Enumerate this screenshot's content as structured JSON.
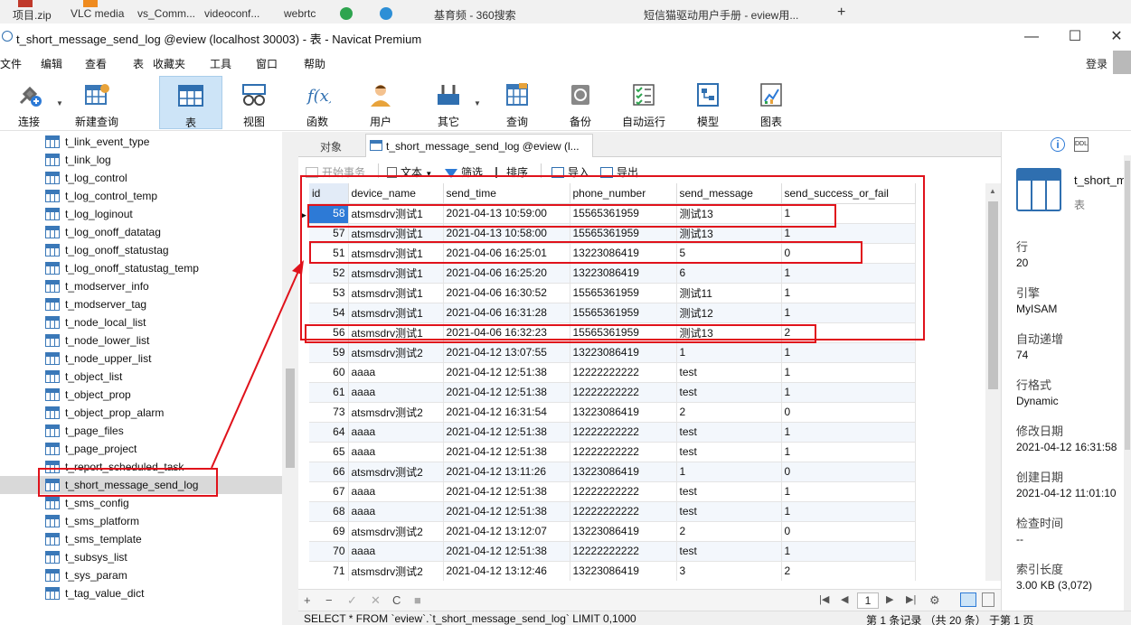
{
  "taskbar": {
    "items": [
      "项目.zip",
      "VLC media",
      "vs_Comm...",
      "videoconf...",
      "webrtc",
      "基育频 - 360搜索",
      "短信猫驱动用户手册 - eview用..."
    ]
  },
  "window": {
    "title": "t_short_message_send_log @eview (localhost 30003) - 表 - Navicat Premium",
    "minimize": "—",
    "maximize": "☐",
    "close": "✕"
  },
  "menu": {
    "items": [
      "文件",
      "编辑",
      "查看",
      "表",
      "收藏夹",
      "工具",
      "窗口",
      "帮助"
    ],
    "login": "登录"
  },
  "toolbar": {
    "buttons": [
      "连接",
      "新建查询",
      "表",
      "视图",
      "函数",
      "用户",
      "其它",
      "查询",
      "备份",
      "自动运行",
      "模型",
      "图表"
    ]
  },
  "tree": {
    "items": [
      "t_link_event_type",
      "t_link_log",
      "t_log_control",
      "t_log_control_temp",
      "t_log_loginout",
      "t_log_onoff_datatag",
      "t_log_onoff_statustag",
      "t_log_onoff_statustag_temp",
      "t_modserver_info",
      "t_modserver_tag",
      "t_node_local_list",
      "t_node_lower_list",
      "t_node_upper_list",
      "t_object_list",
      "t_object_prop",
      "t_object_prop_alarm",
      "t_page_files",
      "t_page_project",
      "t_report_scheduled_task",
      "t_short_message_send_log",
      "t_sms_config",
      "t_sms_platform",
      "t_sms_template",
      "t_subsys_list",
      "t_sys_param",
      "t_tag_value_dict"
    ],
    "selected_index": 19
  },
  "tabs": {
    "objects": "对象",
    "current": "t_short_message_send_log @eview (l..."
  },
  "subtoolbar": {
    "begin_transaction": "开始事务",
    "text": "文本",
    "filter": "筛选",
    "sort": "排序",
    "import": "导入",
    "export": "导出"
  },
  "grid": {
    "columns": [
      "id",
      "device_name",
      "send_time",
      "phone_number",
      "send_message",
      "send_success_or_fail"
    ],
    "rows": [
      [
        "58",
        "atsmsdrv测试1",
        "2021-04-13 10:59:00",
        "15565361959",
        "测试13",
        "1"
      ],
      [
        "57",
        "atsmsdrv测试1",
        "2021-04-13 10:58:00",
        "15565361959",
        "测试13",
        "1"
      ],
      [
        "51",
        "atsmsdrv测试1",
        "2021-04-06 16:25:01",
        "13223086419",
        "5",
        "0"
      ],
      [
        "52",
        "atsmsdrv测试1",
        "2021-04-06 16:25:20",
        "13223086419",
        "6",
        "1"
      ],
      [
        "53",
        "atsmsdrv测试1",
        "2021-04-06 16:30:52",
        "15565361959",
        "测试11",
        "1"
      ],
      [
        "54",
        "atsmsdrv测试1",
        "2021-04-06 16:31:28",
        "15565361959",
        "测试12",
        "1"
      ],
      [
        "56",
        "atsmsdrv测试1",
        "2021-04-06 16:32:23",
        "15565361959",
        "测试13",
        "2"
      ],
      [
        "59",
        "atsmsdrv测试2",
        "2021-04-12 13:07:55",
        "13223086419",
        "1",
        "1"
      ],
      [
        "60",
        "aaaa",
        "2021-04-12 12:51:38",
        "12222222222",
        "test",
        "1"
      ],
      [
        "61",
        "aaaa",
        "2021-04-12 12:51:38",
        "12222222222",
        "test",
        "1"
      ],
      [
        "73",
        "atsmsdrv测试2",
        "2021-04-12 16:31:54",
        "13223086419",
        "2",
        "0"
      ],
      [
        "64",
        "aaaa",
        "2021-04-12 12:51:38",
        "12222222222",
        "test",
        "1"
      ],
      [
        "65",
        "aaaa",
        "2021-04-12 12:51:38",
        "12222222222",
        "test",
        "1"
      ],
      [
        "66",
        "atsmsdrv测试2",
        "2021-04-12 13:11:26",
        "13223086419",
        "1",
        "0"
      ],
      [
        "67",
        "aaaa",
        "2021-04-12 12:51:38",
        "12222222222",
        "test",
        "1"
      ],
      [
        "68",
        "aaaa",
        "2021-04-12 12:51:38",
        "12222222222",
        "test",
        "1"
      ],
      [
        "69",
        "atsmsdrv测试2",
        "2021-04-12 13:12:07",
        "13223086419",
        "2",
        "0"
      ],
      [
        "70",
        "aaaa",
        "2021-04-12 12:51:38",
        "12222222222",
        "test",
        "1"
      ],
      [
        "71",
        "atsmsdrv测试2",
        "2021-04-12 13:12:46",
        "13223086419",
        "3",
        "2"
      ]
    ]
  },
  "bottom": {
    "add": "+",
    "remove": "−",
    "apply": "✓",
    "discard": "✕",
    "refresh": "C",
    "stop": "■",
    "first": "|◀",
    "prev": "◀",
    "page": "1",
    "next": "▶",
    "last": "▶|",
    "settings": "⚙"
  },
  "status": {
    "sql": "SELECT * FROM `eview`.`t_short_message_send_log` LIMIT 0,1000",
    "records": "第 1 条记录 （共 20 条） 于第 1 页"
  },
  "info": {
    "table_name": "t_short_message_send_log",
    "table_type": "表",
    "rows_label": "行",
    "rows_value": "20",
    "engine_label": "引擎",
    "engine_value": "MyISAM",
    "auto_inc_label": "自动递增",
    "auto_inc_value": "74",
    "row_format_label": "行格式",
    "row_format_value": "Dynamic",
    "modified_label": "修改日期",
    "modified_value": "2021-04-12 16:31:58",
    "created_label": "创建日期",
    "created_value": "2021-04-12 11:01:10",
    "check_time_label": "检查时间",
    "check_time_value": "--",
    "index_len_label": "索引长度",
    "index_len_value": "3.00 KB (3,072)"
  },
  "colors": {
    "accent": "#2d7ad6",
    "annotation": "#e0121b",
    "toolbar_active": "#cde4f7"
  }
}
